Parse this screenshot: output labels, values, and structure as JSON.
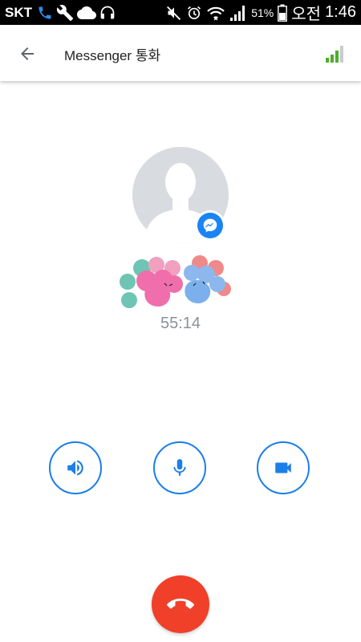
{
  "status_bar": {
    "carrier": "SKT",
    "battery_percent": "51%",
    "ampm": "오전",
    "time": "1:46",
    "icons": [
      "phone-icon",
      "wrench-icon",
      "cloud-icon",
      "headphones-icon",
      "mute-icon",
      "alarm-icon",
      "wifi-icon",
      "cellular-signal-icon",
      "battery-icon"
    ]
  },
  "app_bar": {
    "title": "Messenger 통화",
    "back_icon": "arrow-left-icon",
    "signal_icon": "call-quality-icon",
    "signal_color": "#4caf2a"
  },
  "call": {
    "duration": "55:14",
    "avatar_icon": "default-profile-icon",
    "badge_icon": "messenger-icon",
    "badge_color": "#1a84f5"
  },
  "controls": {
    "speaker_icon": "speaker-icon",
    "mic_icon": "microphone-icon",
    "video_icon": "video-camera-icon",
    "accent_color": "#1a7fe8"
  },
  "end_call": {
    "icon": "hang-up-icon",
    "color": "#f0402a"
  }
}
